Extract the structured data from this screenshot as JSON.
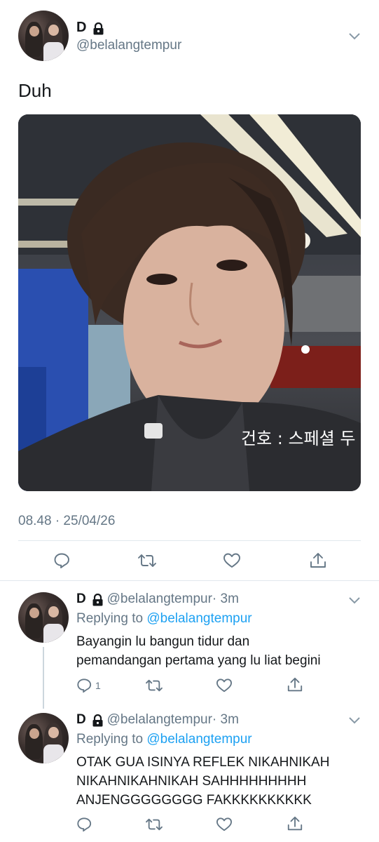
{
  "main_tweet": {
    "name": "D",
    "handle": "@belalangtempur",
    "text": "Duh",
    "timestamp": "08.48 · 25/04/26",
    "media_caption": "건호 : 스페셜 두"
  },
  "replies": [
    {
      "name": "D",
      "handle": "@belalangtempur",
      "time": "· 3m",
      "replying_prefix": "Replying to",
      "replying_to": "@belalangtempur",
      "text_lines": [
        "Bayangin lu bangun tidur dan",
        "pemandangan pertama yang lu liat begini"
      ],
      "reply_count": "1"
    },
    {
      "name": "D",
      "handle": "@belalangtempur",
      "time": "· 3m",
      "replying_prefix": "Replying to",
      "replying_to": "@belalangtempur",
      "text_lines": [
        "OTAK GUA ISINYA REFLEK NIKAHNIKAH",
        "NIKAHNIKAHNIKAH SAHHHHHHHHH",
        "ANJENGGGGGGGG FAKKKKKKKKKK"
      ]
    }
  ],
  "colors": {
    "accent": "#1da1f2",
    "secondary_text": "#657786",
    "divider": "#e1e8ed"
  },
  "icons": [
    "lock-icon",
    "chevron-down-icon",
    "reply-icon",
    "retweet-icon",
    "like-icon",
    "share-icon"
  ]
}
